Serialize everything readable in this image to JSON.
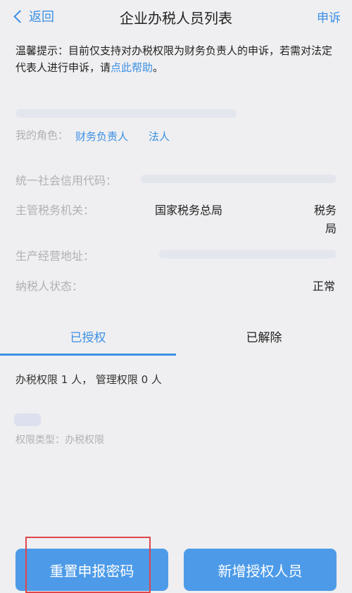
{
  "nav": {
    "back_label": "返回",
    "title": "企业办税人员列表",
    "appeal_label": "申诉"
  },
  "notice": {
    "text": "温馨提示：目前仅支持对办税权限为财务负责人的申诉，若需对法定代表人进行申诉，请",
    "link": "点此帮助",
    "end": "。"
  },
  "company": {
    "role_label": "我的角色：",
    "roles": [
      "财务负责人",
      "法人"
    ]
  },
  "details": {
    "credit_code_label": "统一社会信用代码：",
    "tax_authority_label": "主管税务机关：",
    "tax_authority_value_left": "国家税务总局",
    "tax_authority_value_right_1": "税务",
    "tax_authority_value_right_2": "局",
    "address_label": "生产经营地址：",
    "taxpayer_status_label": "纳税人状态：",
    "taxpayer_status_value": "正常"
  },
  "tabs": {
    "authorized": "已授权",
    "revoked": "已解除"
  },
  "list": {
    "count_text": "办税权限 1 人， 管理权限 0 人",
    "perm_type": "权限类型：办税权限"
  },
  "buttons": {
    "reset_password": "重置申报密码",
    "add_authorized": "新增授权人员"
  },
  "colors": {
    "accent": "#3b8fe4",
    "button": "#4d9be8",
    "highlight": "#e0454a"
  }
}
